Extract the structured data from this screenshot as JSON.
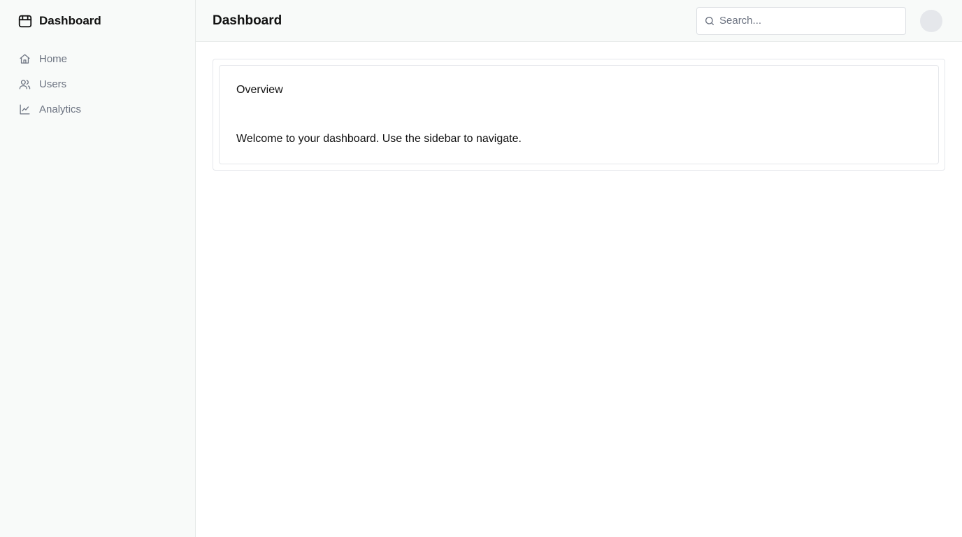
{
  "brand": {
    "name": "Dashboard",
    "icon": "box-icon"
  },
  "sidebar": {
    "items": [
      {
        "label": "Home",
        "icon": "home-icon"
      },
      {
        "label": "Users",
        "icon": "users-icon"
      },
      {
        "label": "Analytics",
        "icon": "chart-line-icon"
      }
    ]
  },
  "header": {
    "title": "Dashboard",
    "search": {
      "placeholder": "Search...",
      "value": ""
    }
  },
  "main": {
    "card": {
      "title": "Overview",
      "text": "Welcome to your dashboard. Use the sidebar to navigate."
    }
  },
  "colors": {
    "sidebar_bg": "#f8faf9",
    "border": "#e6e9e8",
    "nav_text": "#6b7280",
    "avatar": "#e5e7eb"
  }
}
